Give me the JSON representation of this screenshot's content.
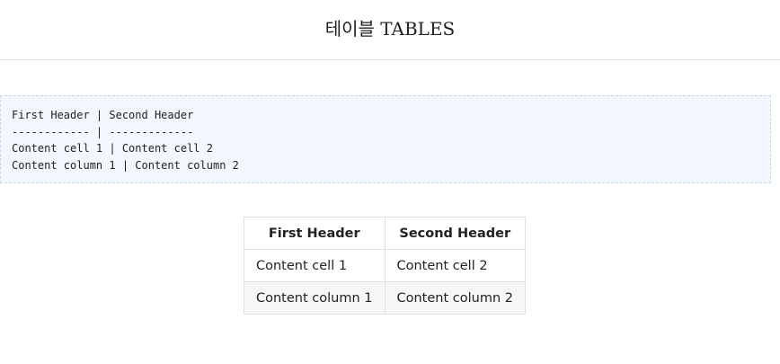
{
  "header": {
    "title": "테이블 TABLES"
  },
  "code": {
    "lines": [
      "First Header | Second Header",
      "------------ | -------------",
      "Content cell 1 | Content cell 2",
      "Content column 1 | Content column 2"
    ]
  },
  "table": {
    "headers": [
      "First Header",
      "Second Header"
    ],
    "rows": [
      [
        "Content cell 1",
        "Content cell 2"
      ],
      [
        "Content column 1",
        "Content column 2"
      ]
    ]
  },
  "colors": {
    "code_background": "#f1f7fd",
    "code_border": "#c6d8ea",
    "table_border": "#e0e0e0",
    "alt_row_background": "#f6f6f6"
  }
}
